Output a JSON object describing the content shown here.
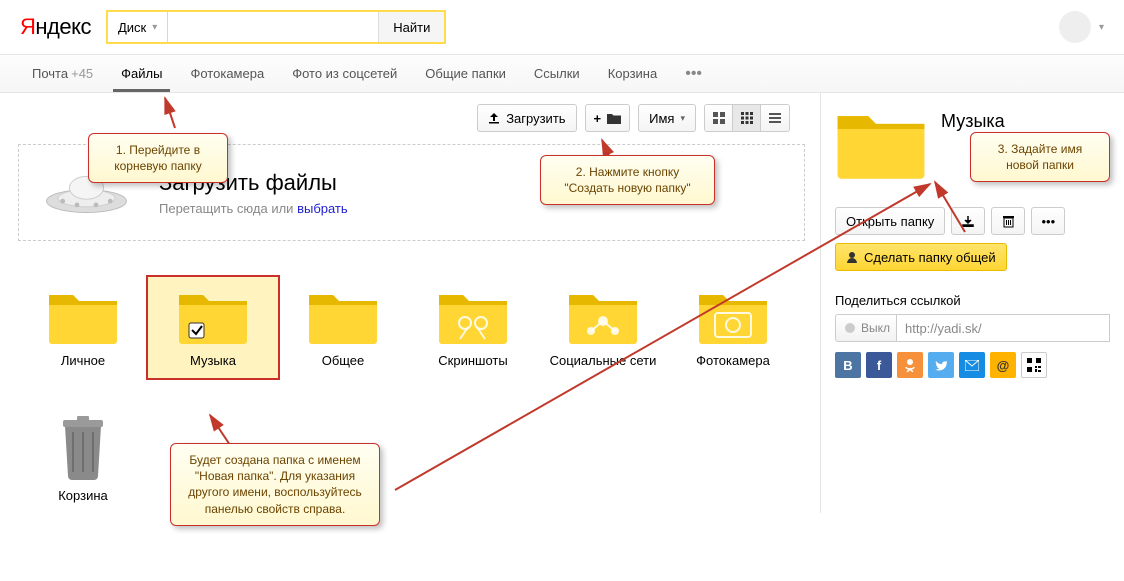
{
  "header": {
    "logo_prefix": "Я",
    "logo_rest": "ндекс",
    "service": "Диск",
    "search_button": "Найти"
  },
  "nav": {
    "mail": "Почта",
    "mail_count": "+45",
    "files": "Файлы",
    "camera": "Фотокамера",
    "social_photos": "Фото из соцсетей",
    "shared": "Общие папки",
    "links": "Ссылки",
    "trash": "Корзина"
  },
  "toolbar": {
    "upload": "Загрузить",
    "new_folder_title": "Создать новую папку",
    "sort_name": "Имя"
  },
  "dropzone": {
    "title": "Загрузить файлы",
    "subtitle_prefix": "Перетащить сюда или ",
    "subtitle_link": "выбрать"
  },
  "grid": {
    "items": [
      {
        "label": "Личное"
      },
      {
        "label": "Музыка"
      },
      {
        "label": "Общее"
      },
      {
        "label": "Скриншоты"
      },
      {
        "label": "Социальные сети"
      },
      {
        "label": "Фотокамера"
      }
    ],
    "trash_label": "Корзина"
  },
  "callouts": {
    "c1": "1. Перейдите в корневую папку",
    "c2": "2. Нажмите кнопку \"Создать новую папку\"",
    "c3": "3. Задайте имя новой папки",
    "c4": "Будет создана папка с именем \"Новая папка\". Для указания другого имени, воспользуйтесь панелью свойств справа."
  },
  "right": {
    "title": "Музыка",
    "open": "Открыть папку",
    "share": "Сделать папку общей",
    "link_label": "Поделиться ссылкой",
    "toggle": "Выкл",
    "link_value": "http://yadi.sk/"
  }
}
